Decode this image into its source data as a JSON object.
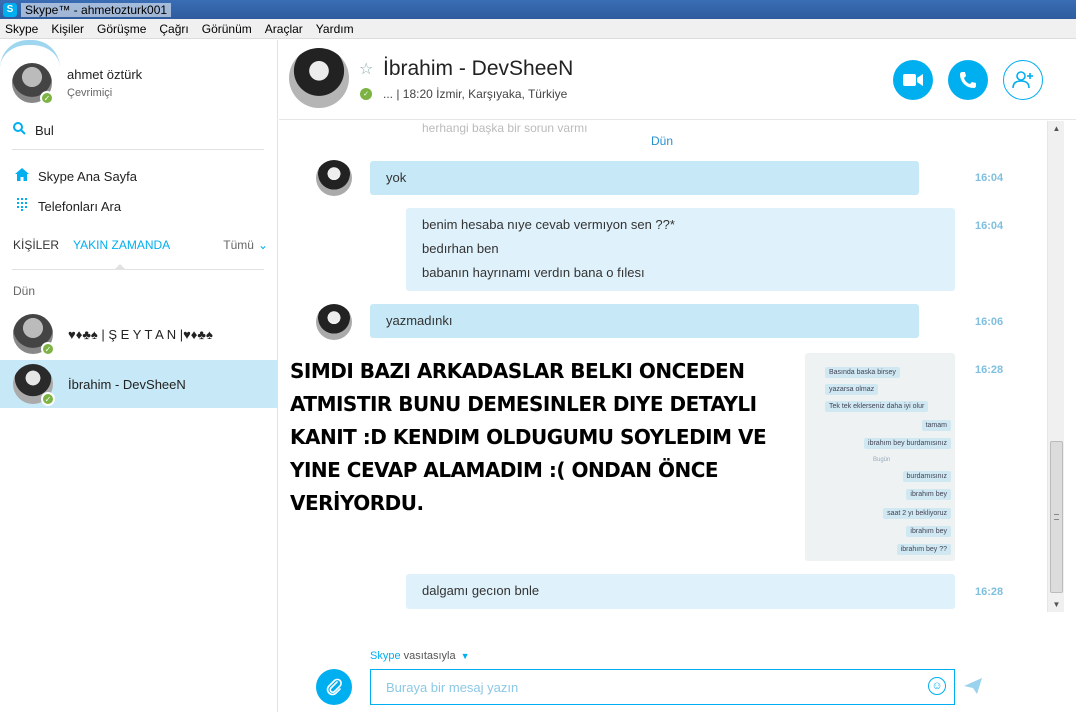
{
  "window": {
    "title": "Skype™ - ahmetozturk001"
  },
  "menu": [
    "Skype",
    "Kişiler",
    "Görüşme",
    "Çağrı",
    "Görünüm",
    "Araçlar",
    "Yardım"
  ],
  "profile": {
    "name": "ahmet öztürk",
    "status": "Çevrimiçi"
  },
  "sidebar": {
    "search_label": "Bul",
    "links": [
      {
        "label": "Skype Ana Sayfa",
        "icon": "home-icon"
      },
      {
        "label": "Telefonları Ara",
        "icon": "dialpad-icon"
      }
    ],
    "tabs": {
      "contacts": "KİŞİLER",
      "recent": "YAKIN ZAMANDA",
      "filter": "Tümü"
    },
    "section": "Dün",
    "contacts": [
      {
        "name": "♥♦♣♠ | Ş E Y T A N |♥♦♣♠",
        "selected": false
      },
      {
        "name": "İbrahim - DevSheeN",
        "selected": true
      }
    ]
  },
  "chat": {
    "contact_name": "İbrahim - DevSheeN",
    "meta": "... | 18:20 İzmir, Karşıyaka, Türkiye",
    "ghost_text": "herhangi başka bir sorun varmı",
    "day_label": "Dün",
    "messages": [
      {
        "id": "m1",
        "direction": "in",
        "lines": [
          "yok"
        ],
        "time": "16:04"
      },
      {
        "id": "m2",
        "direction": "out",
        "lines": [
          "benim hesaba nıye cevab vermıyon sen ??*",
          "bedırhan ben",
          "babanın hayrınamı verdın bana o fılesı"
        ],
        "time": "16:04"
      },
      {
        "id": "m3",
        "direction": "in",
        "lines": [
          "yazmadınkı"
        ],
        "time": "16:06"
      },
      {
        "id": "m4",
        "direction": "out",
        "type": "image",
        "time": "16:28"
      },
      {
        "id": "m5",
        "direction": "out",
        "lines": [
          "dalgamı gecıon bnle"
        ],
        "time": "16:28"
      }
    ],
    "image_thumb": {
      "left_bubbles": [
        "Basında baska birsey",
        "yazarsa olmaz",
        "Tek tek eklerseniz daha iyi olur"
      ],
      "right_bubbles_top": [
        "tamam",
        "ibrahım bey burdamısınız"
      ],
      "day": "Bugün",
      "right_bubbles_bottom": [
        "burdamısınız",
        "ibrahım bey",
        "saat 2 yı bekliyoruz",
        "ibrahım bey",
        "ibrahım bey ??"
      ]
    },
    "overlay_text": "SIMDI BAZI ARKADASLAR BELKI ONCEDEN ATMISTIR BUNU DEMESINLER DIYE DETAYLI KANIT :D KENDIM OLDUGUMU SOYLEDIM VE YINE CEVAP ALAMADIM :( ONDAN ÖNCE VERİYORDU."
  },
  "composer": {
    "via_brand": "Skype",
    "via_text": "vasıtasıyla",
    "placeholder": "Buraya bir mesaj yazın"
  },
  "colors": {
    "accent": "#00aff0",
    "bubble": "#c7e8f6",
    "online": "#7cb342"
  }
}
